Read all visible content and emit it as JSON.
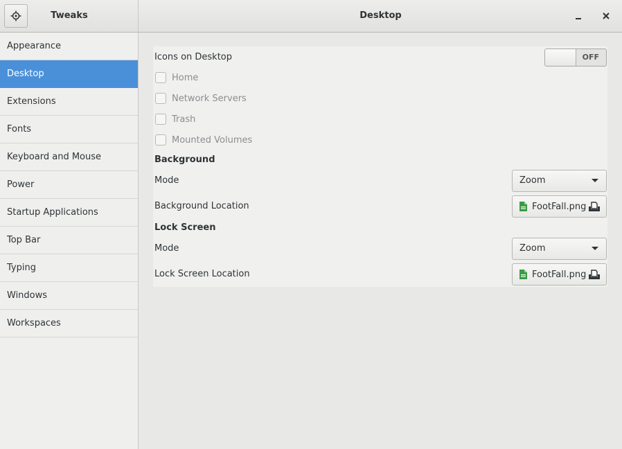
{
  "app": {
    "title": "Tweaks",
    "window_title": "Desktop"
  },
  "sidebar": {
    "items": [
      {
        "label": "Appearance"
      },
      {
        "label": "Desktop",
        "active": true
      },
      {
        "label": "Extensions"
      },
      {
        "label": "Fonts"
      },
      {
        "label": "Keyboard and Mouse"
      },
      {
        "label": "Power"
      },
      {
        "label": "Startup Applications"
      },
      {
        "label": "Top Bar"
      },
      {
        "label": "Typing"
      },
      {
        "label": "Windows"
      },
      {
        "label": "Workspaces"
      }
    ]
  },
  "desktop": {
    "icons_label": "Icons on Desktop",
    "icons_switch": {
      "state": "OFF"
    },
    "checkboxes": [
      {
        "label": "Home",
        "checked": false
      },
      {
        "label": "Network Servers",
        "checked": false
      },
      {
        "label": "Trash",
        "checked": false
      },
      {
        "label": "Mounted Volumes",
        "checked": false
      }
    ],
    "background": {
      "heading": "Background",
      "mode_label": "Mode",
      "mode_value": "Zoom",
      "location_label": "Background Location",
      "location_file": "FootFall.png"
    },
    "lock_screen": {
      "heading": "Lock Screen",
      "mode_label": "Mode",
      "mode_value": "Zoom",
      "location_label": "Lock Screen Location",
      "location_file": "FootFall.png"
    }
  },
  "colors": {
    "accent": "#4a90d9",
    "file_icon": "#3a9b44"
  },
  "icons": {
    "search": "crosshair-search-icon",
    "minimize": "minimize-icon",
    "close": "close-icon",
    "dropdown": "chevron-down-icon",
    "file": "image-file-icon",
    "open": "open-file-icon"
  }
}
